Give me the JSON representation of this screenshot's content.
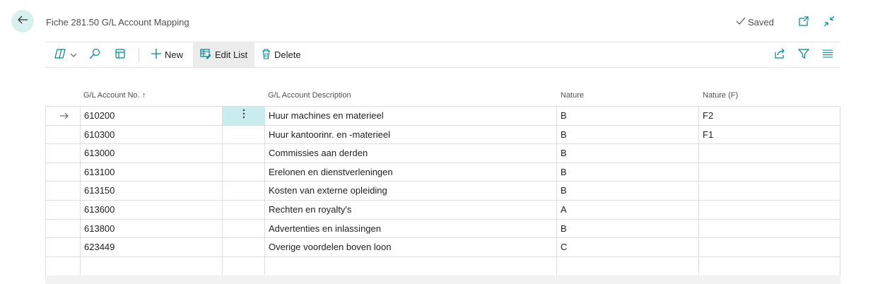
{
  "header": {
    "title": "Fiche 281.50 G/L Account Mapping",
    "saved_label": "Saved"
  },
  "toolbar": {
    "new_label": "New",
    "edit_list_label": "Edit List",
    "delete_label": "Delete"
  },
  "table": {
    "columns": {
      "account_no": "G/L Account No. ↑",
      "description": "G/L Account Description",
      "nature": "Nature",
      "nature_f": "Nature (F)"
    },
    "rows": [
      {
        "account_no": "610200",
        "description": "Huur machines en materieel",
        "nature": "B",
        "nature_f": "F2"
      },
      {
        "account_no": "610300",
        "description": "Huur kantoorinr. en -materieel",
        "nature": "B",
        "nature_f": "F1"
      },
      {
        "account_no": "613000",
        "description": "Commissies aan derden",
        "nature": "B",
        "nature_f": ""
      },
      {
        "account_no": "613100",
        "description": "Erelonen en dienstverleningen",
        "nature": "B",
        "nature_f": ""
      },
      {
        "account_no": "613150",
        "description": "Kosten van externe opleiding",
        "nature": "B",
        "nature_f": ""
      },
      {
        "account_no": "613600",
        "description": "Rechten en royalty's",
        "nature": "A",
        "nature_f": ""
      },
      {
        "account_no": "613800",
        "description": "Advertenties en inlassingen",
        "nature": "B",
        "nature_f": ""
      },
      {
        "account_no": "623449",
        "description": "Overige voordelen boven loon",
        "nature": "C",
        "nature_f": ""
      },
      {
        "account_no": "",
        "description": "",
        "nature": "",
        "nature_f": ""
      }
    ],
    "selected_row_index": 0
  },
  "colors": {
    "accent": "#00838f",
    "selected_cell": "#c9ecee",
    "back_button_bg": "#d9eff0"
  },
  "icons": {
    "back": "arrow-left-icon",
    "saved": "checkmark-icon",
    "open_new_window": "open-in-new-window-icon",
    "collapse": "collapse-icon",
    "copilot": "copilot-icon",
    "search": "search-icon",
    "focus": "focus-mode-icon",
    "new": "plus-icon",
    "edit_list": "edit-list-icon",
    "delete": "trash-icon",
    "share": "share-icon",
    "filter": "filter-icon",
    "columns": "list-columns-icon",
    "row_indicator": "arrow-right-icon",
    "row_actions": "more-vertical-icon"
  }
}
